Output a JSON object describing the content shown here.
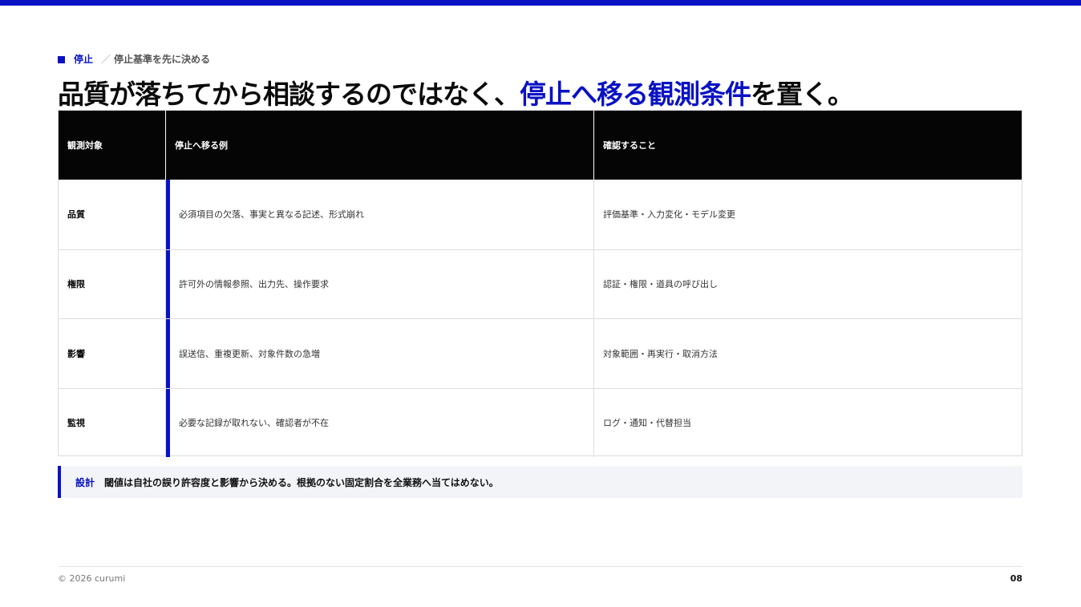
{
  "section": {
    "label": "停止",
    "separator": "／",
    "subtitle": "停止基準を先に決める"
  },
  "headline": {
    "before": "品質が落ちてから相談するのではなく、",
    "accent": "停止へ移る観測条件",
    "after": "を置く。"
  },
  "table": {
    "headers": [
      "観測対象",
      "停止へ移る例",
      "確認すること"
    ],
    "rows": [
      {
        "target": "品質",
        "example": "必須項目の欠落、事実と異なる記述、形式崩れ",
        "check": "評価基準・入力変化・モデル変更"
      },
      {
        "target": "権限",
        "example": "許可外の情報参照、出力先、操作要求",
        "check": "認証・権限・道具の呼び出し"
      },
      {
        "target": "影響",
        "example": "誤送信、重複更新、対象件数の急増",
        "check": "対象範囲・再実行・取消方法"
      },
      {
        "target": "監視",
        "example": "必要な記録が取れない、確認者が不在",
        "check": "ログ・通知・代替担当"
      }
    ]
  },
  "callout": {
    "tag": "設計",
    "text": "閾値は自社の誤り許容度と影響から決める。根拠のない固定割合を全業務へ当てはめない。"
  },
  "footer": {
    "copyright": "© 2026 curumi",
    "page_number": "08"
  },
  "colors": {
    "accent": "#0a12c4",
    "header_bg": "#050505",
    "callout_bg": "#f3f4f8"
  }
}
